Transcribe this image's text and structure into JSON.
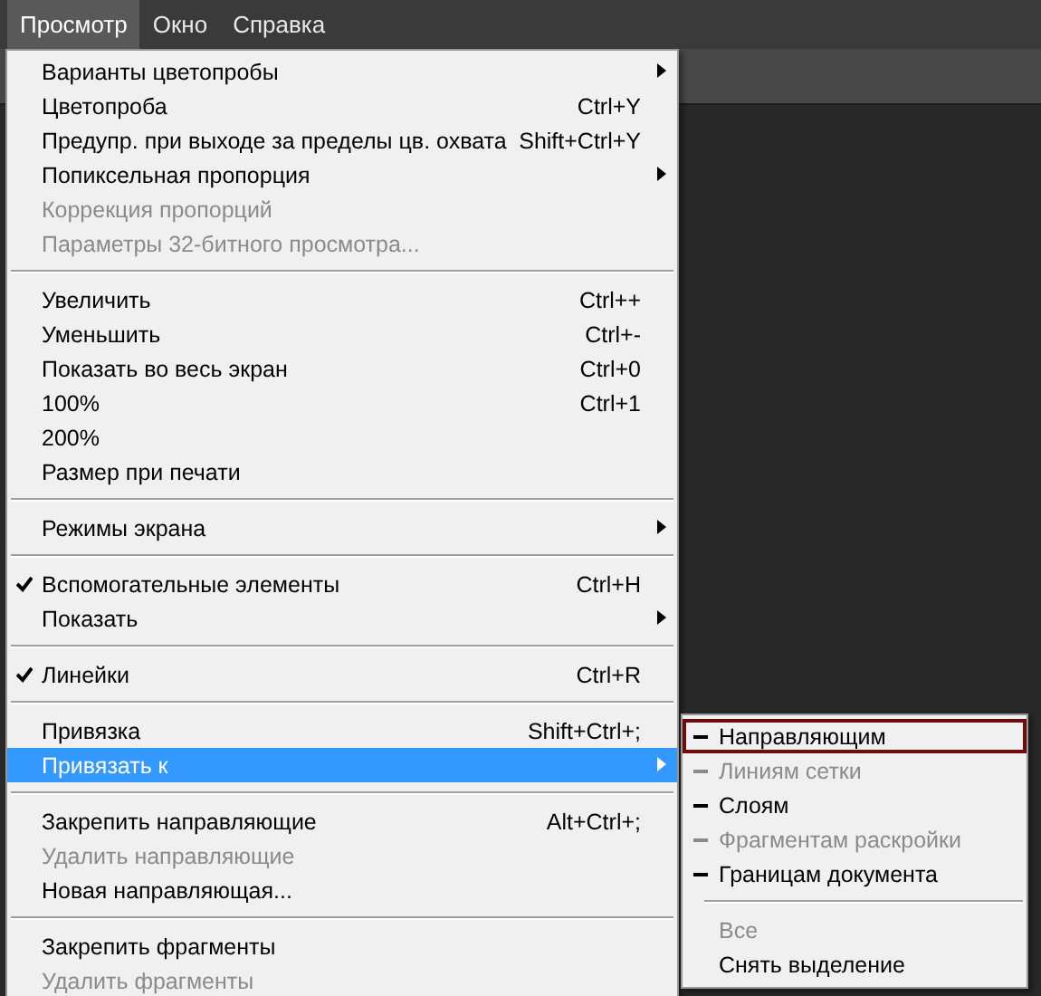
{
  "menubar": [
    {
      "label": "Просмотр",
      "selected": true
    },
    {
      "label": "Окно",
      "selected": false
    },
    {
      "label": "Справка",
      "selected": false
    }
  ],
  "menu": {
    "sections": [
      {
        "items": [
          {
            "label": "Варианты цветопробы",
            "has_submenu": true,
            "checked": false,
            "disabled": false,
            "selected": false
          },
          {
            "label": "Цветопроба",
            "shortcut": "Ctrl+Y",
            "has_submenu": false,
            "checked": false,
            "disabled": false,
            "selected": false
          },
          {
            "label": "Предупр. при выходе за пределы цв. охвата",
            "shortcut": "Shift+Ctrl+Y",
            "has_submenu": false,
            "checked": false,
            "disabled": false,
            "selected": false
          },
          {
            "label": "Попиксельная пропорция",
            "has_submenu": true,
            "checked": false,
            "disabled": false,
            "selected": false
          },
          {
            "label": "Коррекция пропорций",
            "has_submenu": false,
            "checked": false,
            "disabled": true,
            "selected": false
          },
          {
            "label": "Параметры 32-битного просмотра...",
            "has_submenu": false,
            "checked": false,
            "disabled": true,
            "selected": false
          }
        ]
      },
      {
        "items": [
          {
            "label": "Увеличить",
            "shortcut": "Ctrl++",
            "has_submenu": false,
            "checked": false,
            "disabled": false,
            "selected": false
          },
          {
            "label": "Уменьшить",
            "shortcut": "Ctrl+-",
            "has_submenu": false,
            "checked": false,
            "disabled": false,
            "selected": false
          },
          {
            "label": "Показать во весь экран",
            "shortcut": "Ctrl+0",
            "has_submenu": false,
            "checked": false,
            "disabled": false,
            "selected": false
          },
          {
            "label": "100%",
            "shortcut": "Ctrl+1",
            "has_submenu": false,
            "checked": false,
            "disabled": false,
            "selected": false
          },
          {
            "label": "200%",
            "has_submenu": false,
            "checked": false,
            "disabled": false,
            "selected": false
          },
          {
            "label": "Размер при печати",
            "has_submenu": false,
            "checked": false,
            "disabled": false,
            "selected": false
          }
        ]
      },
      {
        "items": [
          {
            "label": "Режимы экрана",
            "has_submenu": true,
            "checked": false,
            "disabled": false,
            "selected": false
          }
        ]
      },
      {
        "items": [
          {
            "label": "Вспомогательные элементы",
            "shortcut": "Ctrl+H",
            "has_submenu": false,
            "checked": true,
            "disabled": false,
            "selected": false
          },
          {
            "label": "Показать",
            "has_submenu": true,
            "checked": false,
            "disabled": false,
            "selected": false
          }
        ]
      },
      {
        "items": [
          {
            "label": "Линейки",
            "shortcut": "Ctrl+R",
            "has_submenu": false,
            "checked": true,
            "disabled": false,
            "selected": false
          }
        ]
      },
      {
        "items": [
          {
            "label": "Привязка",
            "shortcut": "Shift+Ctrl+;",
            "has_submenu": false,
            "checked": false,
            "disabled": false,
            "selected": false
          },
          {
            "label": "Привязать к",
            "has_submenu": true,
            "checked": false,
            "disabled": false,
            "selected": true
          }
        ]
      },
      {
        "items": [
          {
            "label": "Закрепить направляющие",
            "shortcut": "Alt+Ctrl+;",
            "has_submenu": false,
            "checked": false,
            "disabled": false,
            "selected": false
          },
          {
            "label": "Удалить направляющие",
            "has_submenu": false,
            "checked": false,
            "disabled": true,
            "selected": false
          },
          {
            "label": "Новая направляющая...",
            "has_submenu": false,
            "checked": false,
            "disabled": false,
            "selected": false
          }
        ]
      },
      {
        "items": [
          {
            "label": "Закрепить фрагменты",
            "has_submenu": false,
            "checked": false,
            "disabled": false,
            "selected": false
          },
          {
            "label": "Удалить фрагменты",
            "has_submenu": false,
            "checked": false,
            "disabled": true,
            "selected": false
          }
        ]
      }
    ]
  },
  "submenu": {
    "sections": [
      {
        "items": [
          {
            "label": "Направляющим",
            "checked": true,
            "disabled": false,
            "selected": true
          },
          {
            "label": "Линиям сетки",
            "checked": true,
            "disabled": true,
            "selected": false
          },
          {
            "label": "Слоям",
            "checked": true,
            "disabled": false,
            "selected": false
          },
          {
            "label": "Фрагментам раскройки",
            "checked": true,
            "disabled": true,
            "selected": false
          },
          {
            "label": "Границам документа",
            "checked": true,
            "disabled": false,
            "selected": false
          }
        ]
      },
      {
        "items": [
          {
            "label": "Все",
            "checked": false,
            "disabled": true,
            "selected": false
          },
          {
            "label": "Снять выделение",
            "checked": false,
            "disabled": false,
            "selected": false
          }
        ]
      }
    ]
  }
}
